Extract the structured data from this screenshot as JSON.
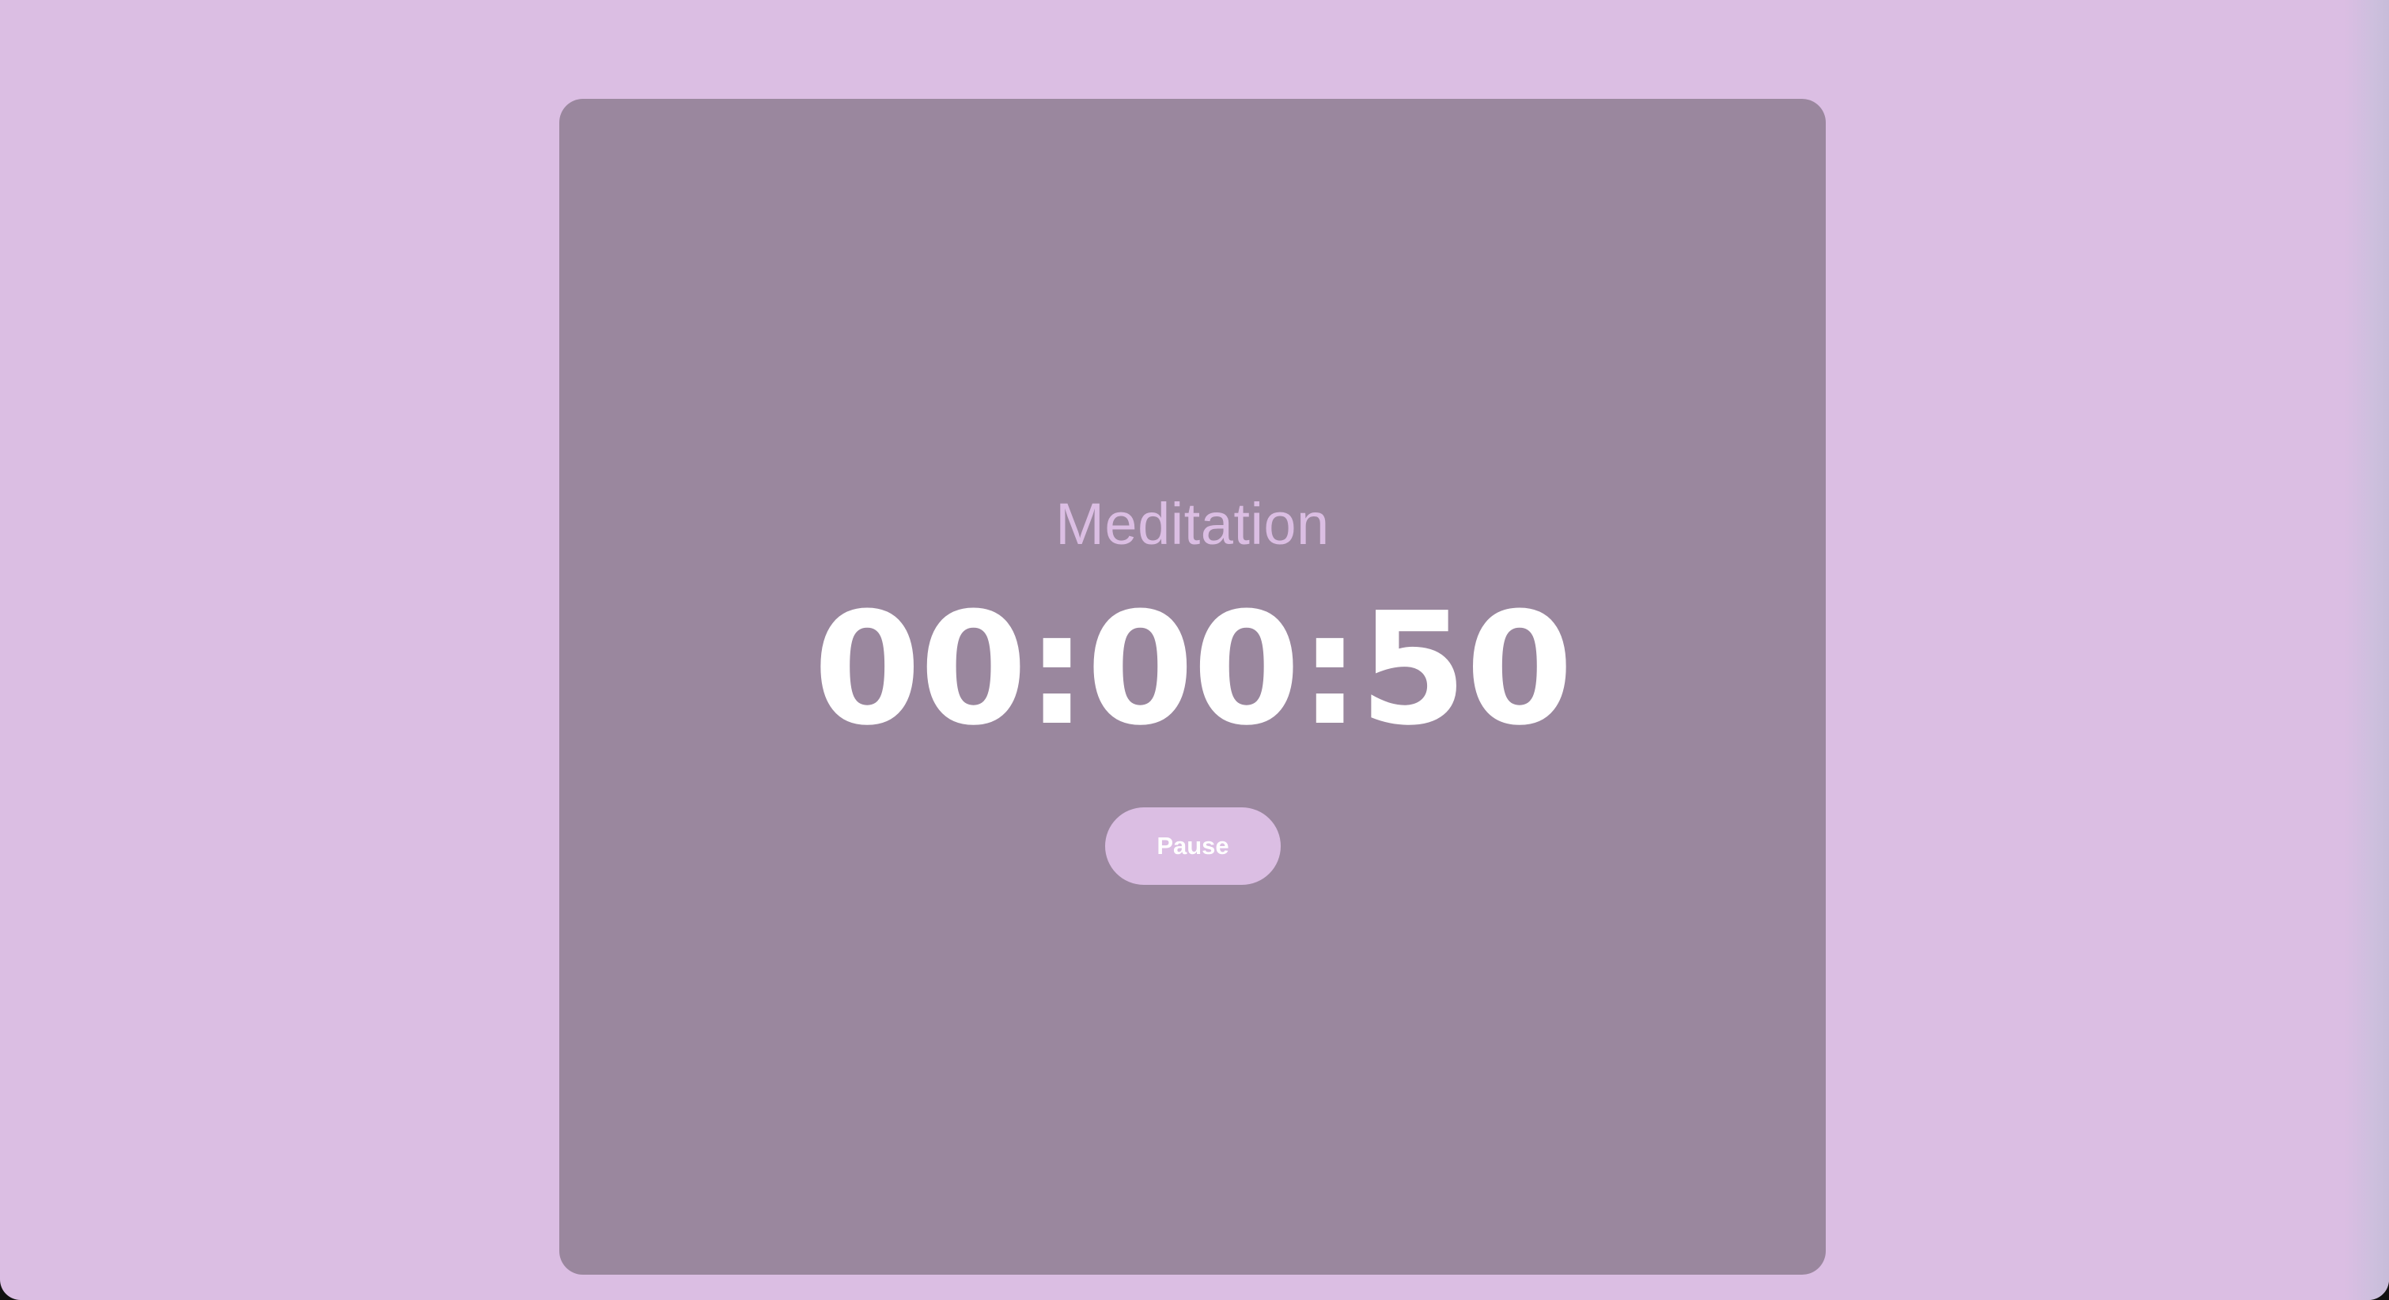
{
  "app": {
    "colors": {
      "background": "#dbbee3",
      "card": "#9a879e",
      "label": "#dbbee3",
      "timer": "#ffffff",
      "button_bg": "#dbbee3",
      "button_text": "#ffffff"
    }
  },
  "timer_card": {
    "session_label": "Meditation",
    "time_display": "00:00:50",
    "pause_button_label": "Pause"
  }
}
